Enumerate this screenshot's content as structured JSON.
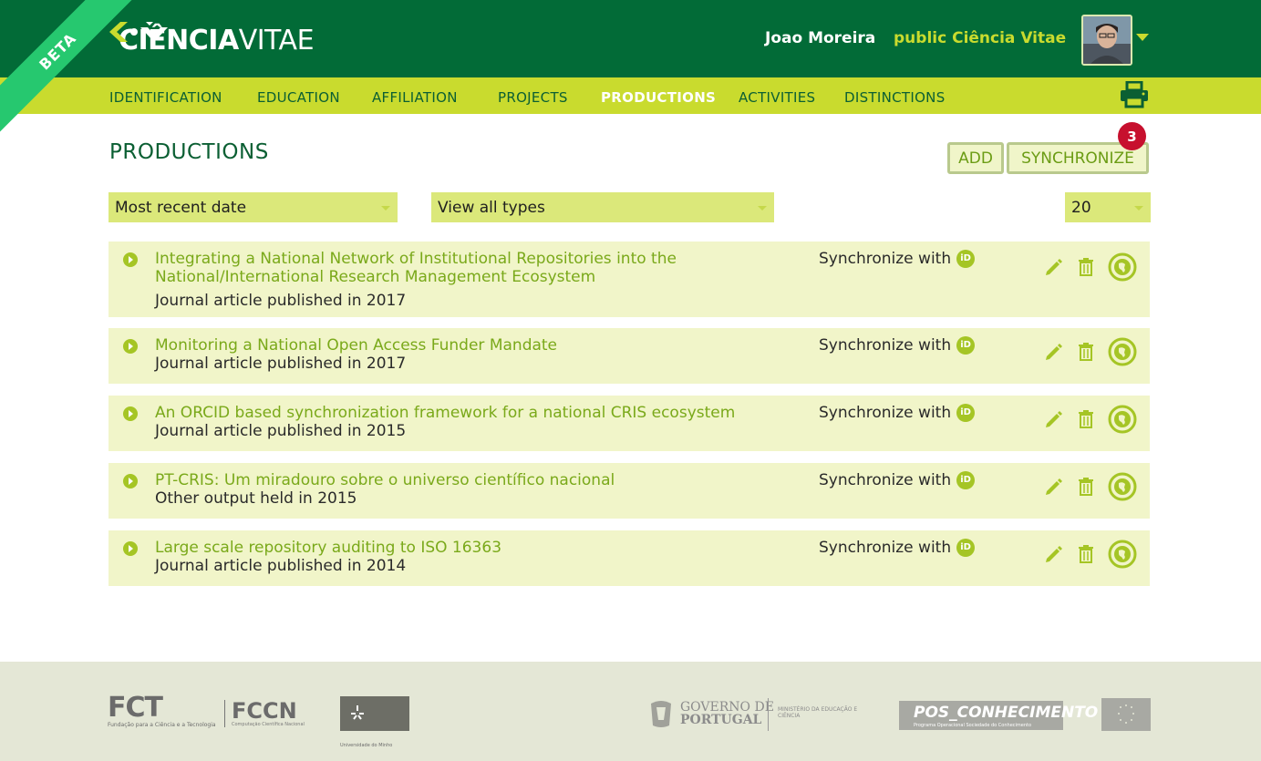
{
  "header": {
    "beta": "BETA",
    "logo_bold": "CIÊNCIA",
    "logo_light": "VITAE",
    "user_name": "Joao Moreira",
    "public_link": "public Ciência Vitae"
  },
  "nav": {
    "items": [
      {
        "label": "IDENTIFICATION",
        "active": false
      },
      {
        "label": "EDUCATION",
        "active": false
      },
      {
        "label": "AFFILIATION",
        "active": false
      },
      {
        "label": "PROJECTS",
        "active": false
      },
      {
        "label": "PRODUCTIONS",
        "active": true
      },
      {
        "label": "ACTIVITIES",
        "active": false
      },
      {
        "label": "DISTINCTIONS",
        "active": false
      }
    ]
  },
  "page": {
    "title": "PRODUCTIONS",
    "add_label": "ADD",
    "sync_label": "SYNCHRONIZE",
    "sync_badge": "3"
  },
  "filters": {
    "sort": "Most recent date",
    "type": "View all types",
    "per_page": "20"
  },
  "productions": [
    {
      "title": "Integrating a National Network of Institutional Repositories into the National/International Research Management Ecosystem",
      "subtitle": "Journal article published in 2017",
      "sync": "Synchronize with"
    },
    {
      "title": "Monitoring a National Open Access Funder Mandate",
      "subtitle": "Journal article published in 2017",
      "sync": "Synchronize with"
    },
    {
      "title": "An ORCID based synchronization framework for a national CRIS ecosystem",
      "subtitle": "Journal article published in 2015",
      "sync": "Synchronize with"
    },
    {
      "title": "PT-CRIS: Um miradouro sobre o universo científico nacional",
      "subtitle": "Other output held in 2015",
      "sync": "Synchronize with"
    },
    {
      "title": "Large scale repository auditing to ISO 16363",
      "subtitle": "Journal article published in 2014",
      "sync": "Synchronize with"
    }
  ],
  "footer": {
    "fct": "FCT",
    "fct_sub": "Fundação para a Ciência e a Tecnologia",
    "fccn": "FCCN",
    "fccn_sub": "Computação Científica Nacional",
    "uminho": "Universidade do Minho",
    "gov_line1": "GOVERNO DE",
    "gov_line2": "PORTUGAL",
    "ministry": "MINISTÉRIO DA EDUCAÇÃO E CIÊNCIA",
    "pos": "POS_CONHECIMENTO",
    "pos_sub": "Programa Operacional Sociedade do Conhecimento"
  },
  "colors": {
    "header_bg": "#026b37",
    "nav_bg": "#c9db2e",
    "row_bg": "#f1f5c9",
    "accent_green": "#7aa91a",
    "badge_red": "#c7102e"
  },
  "icons": [
    "logo-mark-icon",
    "print-icon",
    "orcid-icon",
    "edit-icon",
    "trash-icon",
    "globe-icon",
    "play-bullet-icon",
    "dropdown-caret-icon"
  ]
}
